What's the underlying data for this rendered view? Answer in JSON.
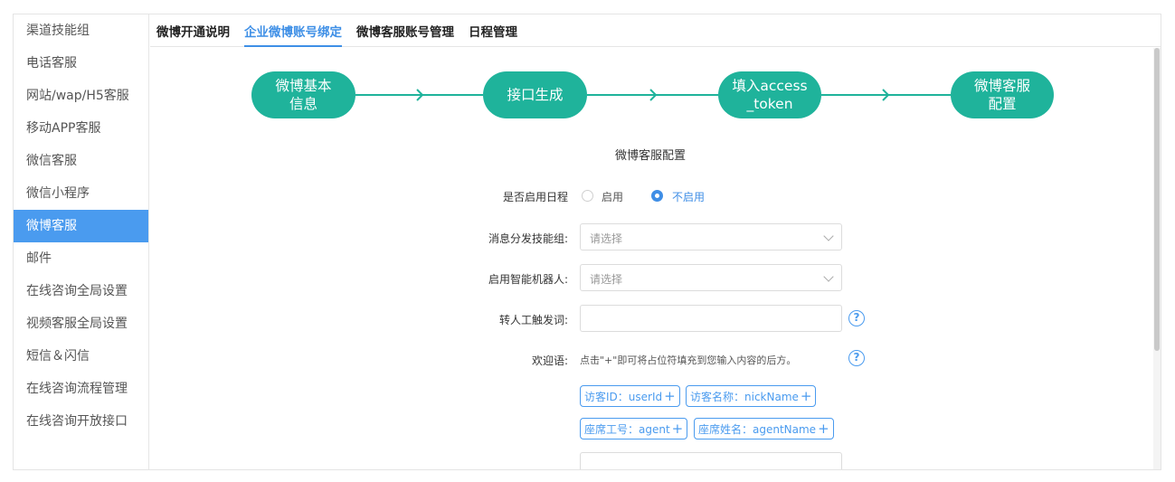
{
  "sidebar": {
    "items": [
      {
        "label": "渠道技能组"
      },
      {
        "label": "电话客服"
      },
      {
        "label": "网站/wap/H5客服"
      },
      {
        "label": "移动APP客服"
      },
      {
        "label": "微信客服"
      },
      {
        "label": "微信小程序"
      },
      {
        "label": "微博客服",
        "active": true
      },
      {
        "label": "邮件"
      },
      {
        "label": "在线咨询全局设置"
      },
      {
        "label": "视频客服全局设置"
      },
      {
        "label": "短信＆闪信"
      },
      {
        "label": "在线咨询流程管理"
      },
      {
        "label": "在线咨询开放接口"
      }
    ]
  },
  "tabs": [
    {
      "label": "微博开通说明"
    },
    {
      "label": "企业微博账号绑定",
      "active": true
    },
    {
      "label": "微博客服账号管理"
    },
    {
      "label": "日程管理"
    }
  ],
  "steps": [
    {
      "label": "微博基本\n信息"
    },
    {
      "label": "接口生成"
    },
    {
      "label": "填入access\n_token"
    },
    {
      "label": "微博客服\n配置"
    }
  ],
  "section_title": "微博客服配置",
  "form": {
    "schedule": {
      "label": "是否启用日程",
      "options": [
        {
          "label": "启用",
          "selected": false
        },
        {
          "label": "不启用",
          "selected": true
        }
      ]
    },
    "skill_group": {
      "label": "消息分发技能组:",
      "placeholder": "请选择"
    },
    "robot": {
      "label": "启用智能机器人:",
      "placeholder": "请选择"
    },
    "transfer_word": {
      "label": "转人工触发词:",
      "value": ""
    },
    "welcome": {
      "label": "欢迎语:",
      "hint": "点击\"+\"即可将占位符填充到您输入内容的后方。",
      "tags": [
        {
          "label": "访客ID：userId"
        },
        {
          "label": "访客名称：nickName"
        },
        {
          "label": "座席工号：agent"
        },
        {
          "label": "座席姓名：agentName"
        }
      ]
    },
    "help_glyph": "?",
    "plus_glyph": "+"
  },
  "colors": {
    "accent": "#4a9bef",
    "step": "#1fb39b"
  }
}
